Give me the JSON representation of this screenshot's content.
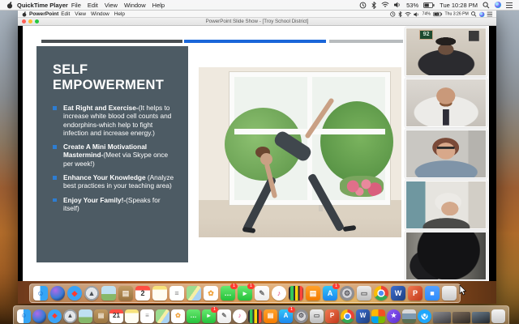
{
  "menubar": {
    "app": "QuickTime Player",
    "menus": [
      "File",
      "Edit",
      "View",
      "Window",
      "Help"
    ],
    "status": {
      "battery": "53%",
      "clock": "Tue 10:28 PM"
    }
  },
  "recording": {
    "menubar": {
      "app": "PowerPoint",
      "menus": [
        "Edit",
        "View",
        "Window",
        "Help"
      ],
      "status": {
        "battery": "74%",
        "clock": "Thu 3:26 PM"
      }
    },
    "window_title": "PowerPoint Slide Show - [Troy School District]",
    "slide": {
      "title_line1": "SELF",
      "title_line2": "EMPOWERMENT",
      "bullets": [
        {
          "lead": "Eat Right and Exercise-",
          "rest": "(It helps to increase white blood cell counts and endorphins-which help to fight infection and increase energy.)"
        },
        {
          "lead": "Create A Mini Motivational Mastermind-",
          "rest": "(Meet via Skype once per week!)"
        },
        {
          "lead": "Enhance Your Knowledge",
          "rest": " (Analyze best practices in your teaching area)"
        },
        {
          "lead": "Enjoy Your Family!-",
          "rest": "(Speaks for itself)"
        }
      ],
      "colors": {
        "panel": "#4d5b64",
        "bullet_marker": "#2d7dd2",
        "bar_dark": "#4a4f52",
        "bar_blue": "#1a66d9",
        "bar_gray": "#b8bcbe"
      }
    },
    "participants": [
      {
        "name": "participant-1",
        "art": "p1",
        "desc": "man in cap, framed jersey behind",
        "jersey": "92"
      },
      {
        "name": "participant-2",
        "art": "p2",
        "desc": "man with beard, shirt and tie"
      },
      {
        "name": "participant-3",
        "art": "p3",
        "desc": "woman with glasses"
      },
      {
        "name": "participant-4",
        "art": "p4",
        "desc": "elderly woman in kitchen"
      },
      {
        "name": "participant-5",
        "art": "p5",
        "desc": "backlit silhouette"
      }
    ],
    "dock": [
      {
        "name": "finder",
        "bg": "linear-gradient(90deg,#ffffff 0 46%,#35a5f5 46%)",
        "glyph": "☺",
        "fg": "#1565c0"
      },
      {
        "name": "siri",
        "shape": "circle",
        "bg": "radial-gradient(circle at 35% 30%,#b06ae8,#3a7bd5 55%,#121236)",
        "glyph": ""
      },
      {
        "name": "safari",
        "shape": "circle",
        "bg": "radial-gradient(circle,#eaf6ff 0 14%,#3aa3f7 15% 84%,#1b7fd4 85%)",
        "glyph": "◆",
        "fg": "#ff3b30"
      },
      {
        "name": "launchpad",
        "shape": "circle",
        "bg": "radial-gradient(circle,#e3e6ea 0 55%,#9aa0a6 56%)",
        "glyph": "▲",
        "fg": "#4a4f55"
      },
      {
        "name": "preview",
        "bg": "linear-gradient(180deg,#bfe0f2 0 55%,#86b86a 55%)",
        "glyph": ""
      },
      {
        "name": "contacts",
        "bg": "linear-gradient(180deg,#c09a62,#9a7440)",
        "glyph": "▤",
        "fg": "#f2e8d8"
      },
      {
        "name": "calendar",
        "bg": "linear-gradient(180deg,#ff4e42 0 30%,#ffffff 30%)",
        "glyph": "2",
        "fg": "#333333"
      },
      {
        "name": "notes",
        "bg": "linear-gradient(180deg,#f7e27b 0 26%,#fffdf2 26%)",
        "glyph": ""
      },
      {
        "name": "reminders",
        "bg": "#ffffff",
        "glyph": "≡",
        "fg": "#8a8a8a"
      },
      {
        "name": "maps",
        "bg": "linear-gradient(125deg,#9ddc8f 0 45%,#f6eea4 45% 62%,#a9d3f5 62%)",
        "glyph": ""
      },
      {
        "name": "photos",
        "bg": "#ffffff",
        "glyph": "✿",
        "fg": "#f0a23c"
      },
      {
        "name": "messages",
        "bg": "linear-gradient(180deg,#67e86f,#25c13b)",
        "glyph": "…",
        "fg": "#ffffff",
        "badge": "1"
      },
      {
        "name": "facetime",
        "bg": "linear-gradient(180deg,#67e86f,#25c13b)",
        "glyph": "▸",
        "fg": "#ffffff",
        "badge": "1"
      },
      {
        "name": "textedit",
        "bg": "linear-gradient(180deg,#ffffff,#ececec)",
        "glyph": "✎",
        "fg": "#6f6f6f"
      },
      {
        "name": "itunes",
        "shape": "circle",
        "bg": "radial-gradient(circle,#ffffff 0 78%,#e9e9e9 79%)",
        "glyph": "♪",
        "fg": "#e0447c"
      },
      {
        "name": "stocks-chart",
        "bg": "linear-gradient(90deg,#2e2e33 0 12%,#34c759 12% 32%,#2e2e33 32% 44%,#ffd60a 44% 64%,#2e2e33 64% 76%,#ff453a 76% 96%,#2e2e33 96%)",
        "glyph": ""
      },
      {
        "name": "books",
        "bg": "linear-gradient(180deg,#ffa12b,#f47b00)",
        "glyph": "▤",
        "fg": "#ffffff"
      },
      {
        "name": "app-store",
        "bg": "linear-gradient(180deg,#33c5f8,#1d86ee)",
        "glyph": "A",
        "fg": "#ffffff",
        "badge": "1"
      },
      {
        "name": "system-preferences",
        "shape": "circle",
        "bg": "radial-gradient(circle,#d6d6da 0 45%,#8e8e93 46%)",
        "glyph": "⚙",
        "fg": "#55555c"
      },
      {
        "name": "printer",
        "bg": "linear-gradient(180deg,#ededed,#bdbdbd)",
        "glyph": "▭",
        "fg": "#5e5e5e"
      },
      {
        "name": "chrome",
        "shape": "circle",
        "bg": "radial-gradient(circle,#4f8df5 0 24%,#ffffff 25% 36%,transparent 37%),conic-gradient(#ea4335 0 33%,#34a853 33% 66%,#fbbc05 66%)",
        "glyph": ""
      },
      {
        "name": "word",
        "bg": "linear-gradient(135deg,#3d6fd1,#1e3f7f)",
        "glyph": "W",
        "fg": "#ffffff"
      },
      {
        "name": "powerpoint",
        "bg": "linear-gradient(135deg,#f07a52,#c2391b)",
        "glyph": "P",
        "fg": "#ffffff"
      },
      {
        "name": "zoom",
        "bg": "linear-gradient(180deg,#55a1ff,#2d8cff)",
        "glyph": "■",
        "fg": "#ffffff"
      },
      {
        "name": "trash",
        "bg": "linear-gradient(180deg,#f4f4f4,#c9c9c9)",
        "glyph": ""
      }
    ]
  },
  "dock": [
    {
      "name": "finder",
      "bg": "linear-gradient(90deg,#ffffff 0 46%,#35a5f5 46%)",
      "glyph": "☺",
      "fg": "#1565c0"
    },
    {
      "name": "siri",
      "shape": "circle",
      "bg": "radial-gradient(circle at 35% 30%,#b06ae8,#3a7bd5 55%,#121236)",
      "glyph": ""
    },
    {
      "name": "safari",
      "shape": "circle",
      "bg": "radial-gradient(circle,#eaf6ff 0 14%,#3aa3f7 15% 84%,#1b7fd4 85%)",
      "glyph": "◆",
      "fg": "#ff3b30"
    },
    {
      "name": "launchpad",
      "shape": "circle",
      "bg": "radial-gradient(circle,#e3e6ea 0 55%,#9aa0a6 56%)",
      "glyph": "▲",
      "fg": "#4a4f55"
    },
    {
      "name": "preview",
      "bg": "linear-gradient(180deg,#bfe0f2 0 55%,#86b86a 55%)",
      "glyph": ""
    },
    {
      "name": "contacts",
      "bg": "linear-gradient(180deg,#c09a62,#9a7440)",
      "glyph": "▤",
      "fg": "#f2e8d8"
    },
    {
      "name": "calendar",
      "bg": "linear-gradient(180deg,#ff4e42 0 30%,#ffffff 30%)",
      "glyph": "21",
      "fg": "#333333"
    },
    {
      "name": "notes",
      "bg": "linear-gradient(180deg,#f7e27b 0 26%,#fffdf2 26%)",
      "glyph": ""
    },
    {
      "name": "reminders",
      "bg": "#ffffff",
      "glyph": "≡",
      "fg": "#8a8a8a"
    },
    {
      "name": "maps",
      "bg": "linear-gradient(125deg,#9ddc8f 0 45%,#f6eea4 45% 62%,#a9d3f5 62%)",
      "glyph": ""
    },
    {
      "name": "photos",
      "bg": "#ffffff",
      "glyph": "✿",
      "fg": "#f0a23c"
    },
    {
      "name": "messages",
      "bg": "linear-gradient(180deg,#67e86f,#25c13b)",
      "glyph": "…",
      "fg": "#ffffff"
    },
    {
      "name": "facetime",
      "bg": "linear-gradient(180deg,#67e86f,#25c13b)",
      "glyph": "▸",
      "fg": "#ffffff",
      "badge": "1"
    },
    {
      "name": "textedit",
      "bg": "linear-gradient(180deg,#ffffff,#ececec)",
      "glyph": "✎",
      "fg": "#6f6f6f"
    },
    {
      "name": "itunes",
      "shape": "circle",
      "bg": "radial-gradient(circle,#ffffff 0 78%,#e9e9e9 79%)",
      "glyph": "♪",
      "fg": "#e0447c"
    },
    {
      "name": "stocks-chart",
      "bg": "linear-gradient(90deg,#2e2e33 0 12%,#34c759 12% 32%,#2e2e33 32% 44%,#ffd60a 44% 64%,#2e2e33 64% 76%,#ff453a 76% 96%,#2e2e33 96%)",
      "glyph": ""
    },
    {
      "name": "books",
      "bg": "linear-gradient(180deg,#ffa12b,#f47b00)",
      "glyph": "▤",
      "fg": "#ffffff"
    },
    {
      "name": "app-store",
      "bg": "linear-gradient(180deg,#33c5f8,#1d86ee)",
      "glyph": "A",
      "fg": "#ffffff",
      "badge": "1"
    },
    {
      "name": "system-preferences",
      "shape": "circle",
      "bg": "radial-gradient(circle,#d6d6da 0 45%,#8e8e93 46%)",
      "glyph": "⚙",
      "fg": "#55555c"
    },
    {
      "name": "printer",
      "bg": "linear-gradient(180deg,#ededed,#bdbdbd)",
      "glyph": "▭",
      "fg": "#5e5e5e"
    },
    {
      "name": "powerpoint",
      "bg": "linear-gradient(135deg,#f07a52,#c2391b)",
      "glyph": "P",
      "fg": "#ffffff"
    },
    {
      "name": "chrome",
      "shape": "circle",
      "bg": "radial-gradient(circle,#4f8df5 0 24%,#ffffff 25% 36%,transparent 37%),conic-gradient(#ea4335 0 33%,#34a853 33% 66%,#fbbc05 66%)",
      "glyph": ""
    },
    {
      "name": "word",
      "bg": "linear-gradient(135deg,#3d6fd1,#1e3f7f)",
      "glyph": "W",
      "fg": "#ffffff"
    },
    {
      "name": "office",
      "bg": "conic-gradient(#f25022 0 25%,#7fba00 25% 50%,#00a4ef 50% 75%,#ffb900 75%)",
      "glyph": ""
    },
    {
      "name": "imovie",
      "shape": "circle",
      "bg": "linear-gradient(135deg,#8e5bf5,#5b2fd0)",
      "glyph": "★",
      "fg": "#ffffff"
    },
    {
      "name": "media-browser",
      "bg": "linear-gradient(180deg,#d9d9d9 0 30%,#7f9ab0 30% 70%,#5a6f52 70%)",
      "glyph": ""
    },
    {
      "name": "quicktime",
      "shape": "circle",
      "bg": "radial-gradient(circle,#ffffff 0 32%,#1ea7fd 33%)",
      "glyph": "Q",
      "fg": "#1ea7fd"
    },
    {
      "name": "minimized-window-1",
      "bg": "linear-gradient(160deg,#8a8a8e,#3c3c40)",
      "glyph": ""
    },
    {
      "name": "minimized-window-2",
      "bg": "linear-gradient(160deg,#7b6a5a,#2e2a26)",
      "glyph": ""
    },
    {
      "name": "minimized-window-3",
      "bg": "linear-gradient(160deg,#6a7b8a,#23282e)",
      "glyph": ""
    },
    {
      "name": "trash",
      "bg": "linear-gradient(180deg,#f4f4f4,#c9c9c9)",
      "glyph": ""
    }
  ]
}
